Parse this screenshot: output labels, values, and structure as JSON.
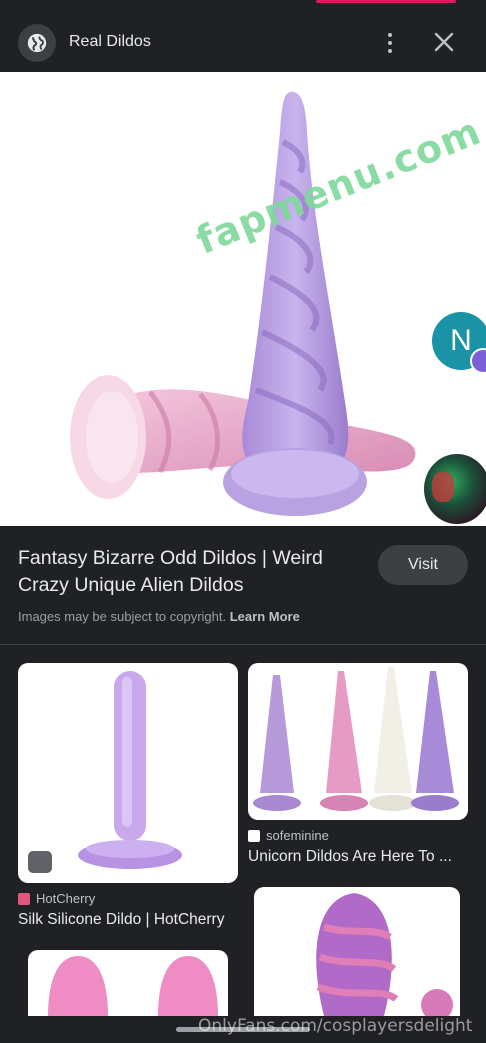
{
  "header": {
    "title": "Real Dildos",
    "site_icon": "globe-icon",
    "more_icon": "more-vert-icon",
    "close_icon": "close-icon"
  },
  "hero": {
    "watermark": "fapmenu.com",
    "side_avatar_letter": "N"
  },
  "info": {
    "title": "Fantasy Bizarre Odd Dildos | Weird Crazy Unique Alien Dildos",
    "visit_label": "Visit",
    "copyright_text": "Images may be subject to copyright.",
    "learn_more": "Learn More"
  },
  "results": [
    {
      "source": "HotCherry",
      "caption": "Silk Silicone Dildo | HotCherry"
    },
    {
      "source": "sofeminine",
      "caption": "Unicorn Dildos Are Here To ..."
    }
  ],
  "footer": {
    "onlyfans_watermark": "OnlyFans.com/cosplayersdelight"
  },
  "colors": {
    "background": "#202124",
    "text": "#e8eaed",
    "muted": "#9aa0a6",
    "button": "#3c4043",
    "watermark": "#7ed99b"
  }
}
